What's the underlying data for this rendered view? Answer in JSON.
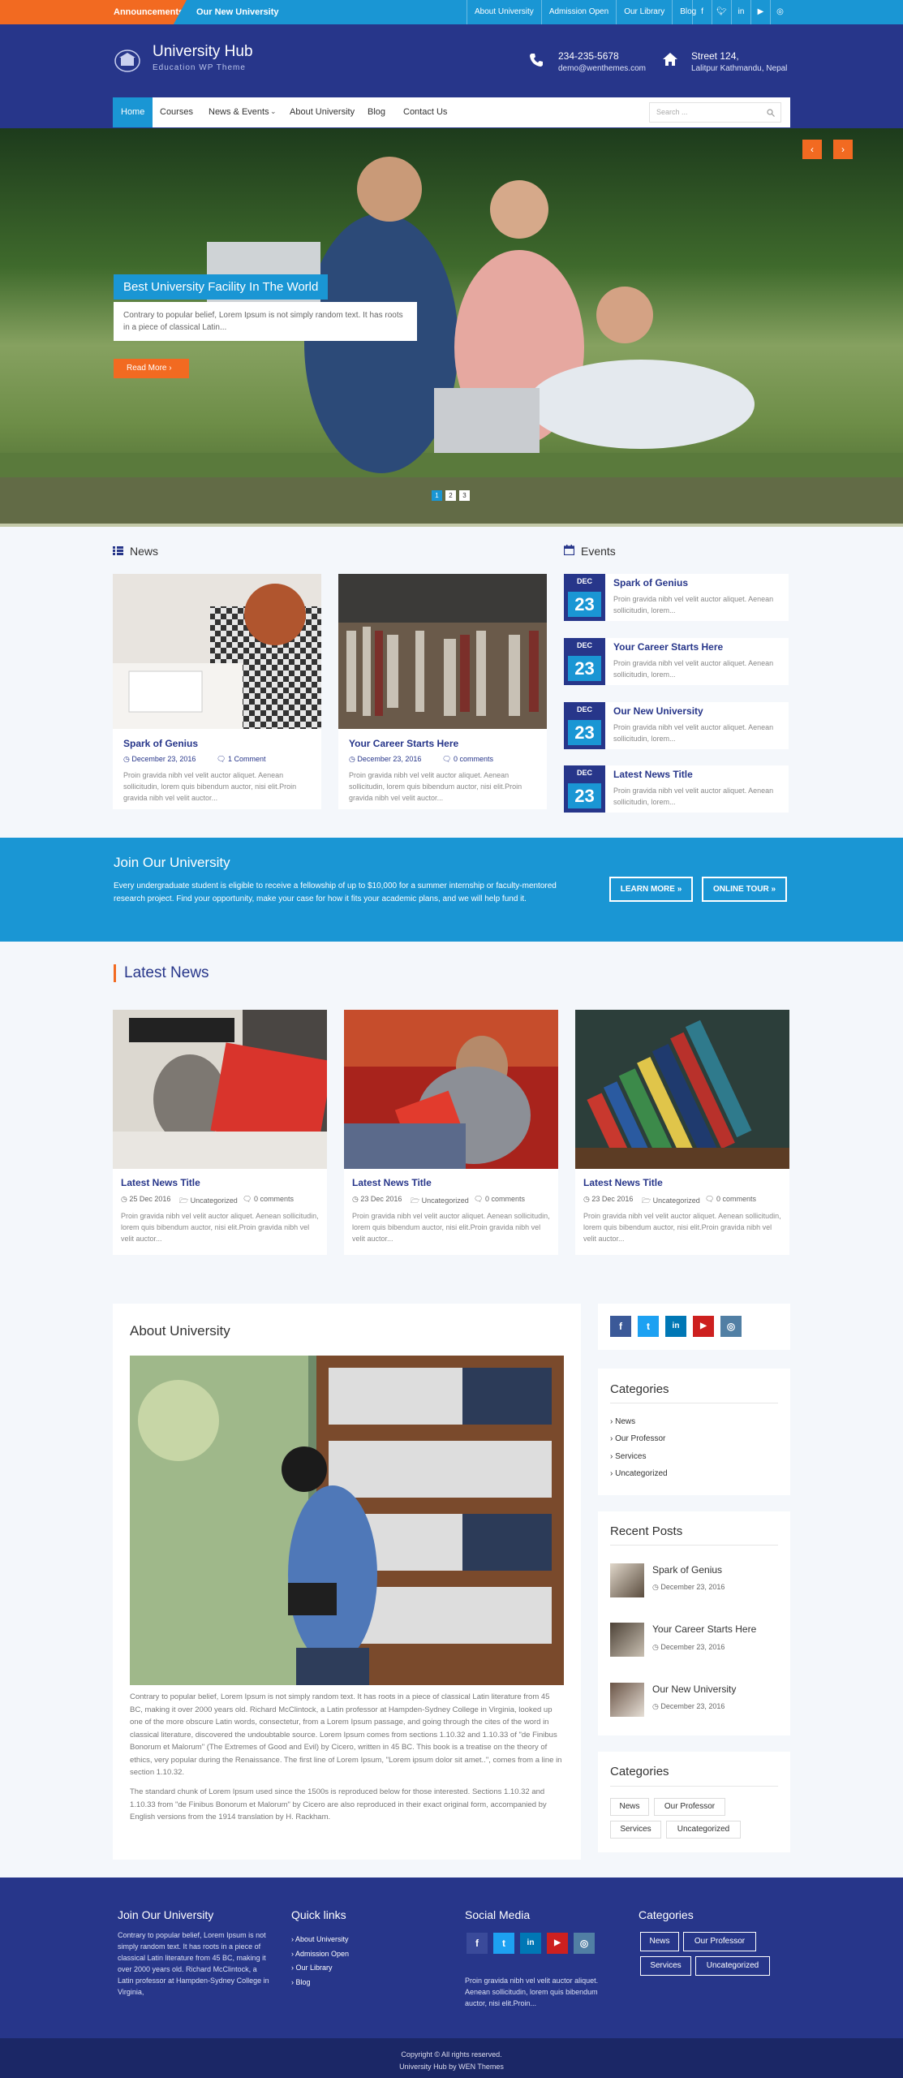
{
  "topbar": {
    "announcements_label": "Announcements:",
    "announcement_text": "Our New University",
    "links": [
      "About University",
      "Admission Open",
      "Our Library",
      "Blog"
    ],
    "social_icons": [
      "facebook-icon",
      "twitter-icon",
      "linkedin-icon",
      "youtube-icon",
      "instagram-icon"
    ]
  },
  "header": {
    "site_title": "University Hub",
    "site_description": "Education WP Theme",
    "phone": "234-235-5678",
    "email": "demo@wenthemes.com",
    "street": "Street 124,",
    "city": "Lalitpur Kathmandu, Nepal"
  },
  "nav": {
    "items": [
      "Home",
      "Courses",
      "News & Events",
      "About University",
      "Blog",
      "Contact Us"
    ],
    "active": "Home",
    "search_placeholder": "Search ..."
  },
  "slider": {
    "title": "Best University Facility In The World",
    "text": "Contrary to popular belief, Lorem Ipsum is not simply random text. It has roots in a piece of classical Latin...",
    "button": "Read More",
    "pages": [
      "1",
      "2",
      "3"
    ],
    "prev": "‹",
    "next": "›"
  },
  "news": {
    "heading": "News",
    "items": [
      {
        "title": "Spark of Genius",
        "date": "December 23, 2016",
        "comments": "1 Comment",
        "excerpt": "Proin gravida nibh vel velit auctor aliquet. Aenean sollicitudin, lorem quis bibendum auctor, nisi elit.Proin gravida nibh vel velit auctor..."
      },
      {
        "title": "Your Career Starts Here",
        "date": "December 23, 2016",
        "comments": "0 comments",
        "excerpt": "Proin gravida nibh vel velit auctor aliquet. Aenean sollicitudin, lorem quis bibendum auctor, nisi elit.Proin gravida nibh vel velit auctor..."
      }
    ]
  },
  "events": {
    "heading": "Events",
    "items": [
      {
        "month": "DEC",
        "day": "23",
        "title": "Spark of Genius",
        "text": "Proin gravida nibh vel velit auctor aliquet. Aenean sollicitudin, lorem..."
      },
      {
        "month": "DEC",
        "day": "23",
        "title": "Your Career Starts Here",
        "text": "Proin gravida nibh vel velit auctor aliquet. Aenean sollicitudin, lorem..."
      },
      {
        "month": "DEC",
        "day": "23",
        "title": "Our New University",
        "text": "Proin gravida nibh vel velit auctor aliquet. Aenean sollicitudin, lorem..."
      },
      {
        "month": "DEC",
        "day": "23",
        "title": "Latest News Title",
        "text": "Proin gravida nibh vel velit auctor aliquet. Aenean sollicitudin, lorem..."
      }
    ]
  },
  "join": {
    "title": "Join Our University",
    "text": "Every undergraduate student is eligible to receive a fellowship of up to $10,000 for a summer internship or faculty-mentored research project. Find your opportunity, make your case for how it fits your academic plans, and we will help fund it.",
    "learn_more": "LEARN MORE »",
    "online_tour": "ONLINE TOUR »"
  },
  "latest_news": {
    "heading": "Latest News",
    "items": [
      {
        "title": "Latest News Title",
        "date": "25 Dec 2016",
        "category": "Uncategorized",
        "comments": "0 comments",
        "excerpt": "Proin gravida nibh vel velit auctor aliquet. Aenean sollicitudin, lorem quis bibendum auctor, nisi elit.Proin gravida nibh vel velit auctor..."
      },
      {
        "title": "Latest News Title",
        "date": "23 Dec 2016",
        "category": "Uncategorized",
        "comments": "0 comments",
        "excerpt": "Proin gravida nibh vel velit auctor aliquet. Aenean sollicitudin, lorem quis bibendum auctor, nisi elit.Proin gravida nibh vel velit auctor..."
      },
      {
        "title": "Latest News Title",
        "date": "23 Dec 2016",
        "category": "Uncategorized",
        "comments": "0 comments",
        "excerpt": "Proin gravida nibh vel velit auctor aliquet. Aenean sollicitudin, lorem quis bibendum auctor, nisi elit.Proin gravida nibh vel velit auctor..."
      }
    ]
  },
  "about": {
    "title": "About University",
    "paragraph1": "Contrary to popular belief, Lorem Ipsum is not simply random text. It has roots in a piece of classical Latin literature from 45 BC, making it over 2000 years old. Richard McClintock, a Latin professor at Hampden-Sydney College in Virginia, looked up one of the more obscure Latin words, consectetur, from a Lorem Ipsum passage, and going through the cites of the word in classical literature, discovered the undoubtable source. Lorem Ipsum comes from sections 1.10.32 and 1.10.33 of \"de Finibus Bonorum et Malorum\" (The Extremes of Good and Evil) by Cicero, written in 45 BC. This book is a treatise on the theory of ethics, very popular during the Renaissance. The first line of Lorem Ipsum, \"Lorem ipsum dolor sit amet..\", comes from a line in section 1.10.32.",
    "paragraph2": "The standard chunk of Lorem Ipsum used since the 1500s is reproduced below for those interested. Sections 1.10.32 and 1.10.33 from \"de Finibus Bonorum et Malorum\" by Cicero are also reproduced in their exact original form, accompanied by English versions from the 1914 translation by H. Rackham."
  },
  "sidebar": {
    "categories_title": "Categories",
    "categories": [
      "News",
      "Our Professor",
      "Services",
      "Uncategorized"
    ],
    "recent_title": "Recent Posts",
    "recent": [
      {
        "title": "Spark of Genius",
        "date": "December 23, 2016"
      },
      {
        "title": "Your Career Starts Here",
        "date": "December 23, 2016"
      },
      {
        "title": "Our New University",
        "date": "December 23, 2016"
      }
    ],
    "tags_title": "Categories",
    "tags": [
      "News",
      "Our Professor",
      "Services",
      "Uncategorized"
    ]
  },
  "footer": {
    "join_title": "Join Our University",
    "join_text": "Contrary to popular belief, Lorem Ipsum is not simply random text. It has roots in a piece of classical Latin literature from 45 BC, making it over 2000 years old. Richard McClintock, a Latin professor at Hampden-Sydney College in Virginia,",
    "quick_title": "Quick links",
    "quick_links": [
      "About University",
      "Admission Open",
      "Our Library",
      "Blog"
    ],
    "social_title": "Social Media",
    "social_text": "Proin gravida nibh vel velit auctor aliquet. Aenean sollicitudin, lorem quis bibendum auctor, nisi elit.Proin...",
    "cat_title": "Categories",
    "tags": [
      "News",
      "Our Professor",
      "Services",
      "Uncategorized"
    ],
    "copyright": "Copyright © All rights reserved.",
    "credit": "University Hub by WEN Themes"
  },
  "colors": {
    "primary": "#27368a",
    "accent": "#1a96d4",
    "highlight": "#f26a21"
  }
}
